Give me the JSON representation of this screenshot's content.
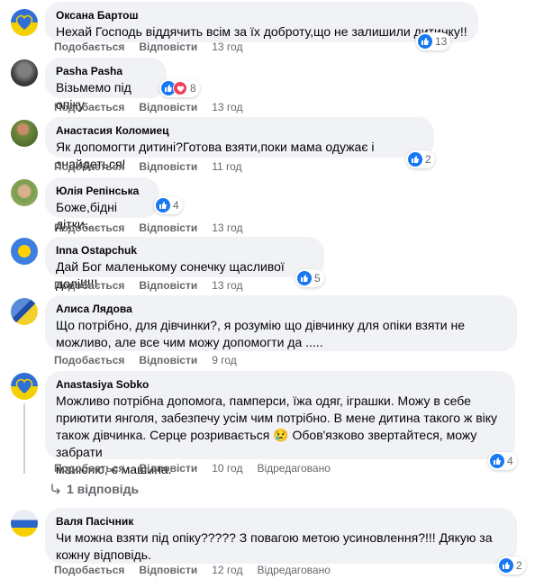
{
  "labels": {
    "like": "Подобається",
    "reply": "Відповісти",
    "edited": "Відредаговано"
  },
  "comments": [
    {
      "author": "Оксана Бартош",
      "text": "Нехай Господь віддячить всім за їх доброту,що не залишили дитинку!!",
      "time": "13 год",
      "reactions": "13",
      "avatar": "ua-heart"
    },
    {
      "author": "Pasha Pasha",
      "text": "Візьмемо під опіку",
      "time": "13 год",
      "reactions": "8",
      "avatar": "dark"
    },
    {
      "author": "Анастасия Коломиец",
      "text": "Як допомогти дитині?Готова взяти,поки мама одужає і знайдеться!",
      "time": "11 год",
      "reactions": "2",
      "avatar": "photo"
    },
    {
      "author": "Юлія Репінська",
      "text": "Боже,бідні дітки...",
      "time": "13 год",
      "reactions": "4",
      "avatar": "photo"
    },
    {
      "author": "Inna Ostapchuk",
      "text": "Дай Бог маленькому сонечку щасливої долі!!!!!",
      "time": "13 год",
      "reactions": "5",
      "avatar": "photo"
    },
    {
      "author": "Алиса Лядова",
      "text_lines": [
        "Що потрібно, для дівчинки?, я розумію що дівчинку для опіки взяти не",
        "можливо, але все чим можу допомогти да ....."
      ],
      "time": "9 год",
      "avatar": "ua-flag"
    },
    {
      "author": "Anastasiya Sobko",
      "text_lines": [
        "Можливо потрібна допомога, памперси, їжа одяг, іграшки. Можу в себе",
        "приютити янголя, забезпечу усім чим потрібно. В мене дитина такого ж віку",
        "також дівчинка. Серце розривається 😢 Обов'язково звертайтеся, можу забрати",
        "манюню, є машина."
      ],
      "time": "10 год",
      "reactions": "4",
      "edited": true,
      "avatar": "ua-heart"
    },
    {
      "author": "Валя Пасічник",
      "text_lines": [
        "Чи можна взяти під опіку????? З повагою метою усиновлення?!!! Дякую за",
        "кожну відповідь."
      ],
      "time": "12 год",
      "reactions": "2",
      "edited": true,
      "avatar": "photo"
    }
  ],
  "replies_link": "1 відповідь",
  "icons": {
    "like": "like-icon",
    "love": "heart-icon",
    "replies_arrow": "reply-arrow-icon"
  },
  "colors": {
    "like": "#1877f2",
    "love": "#f33e58",
    "bubble": "#f0f2f5",
    "meta": "#65676b"
  }
}
